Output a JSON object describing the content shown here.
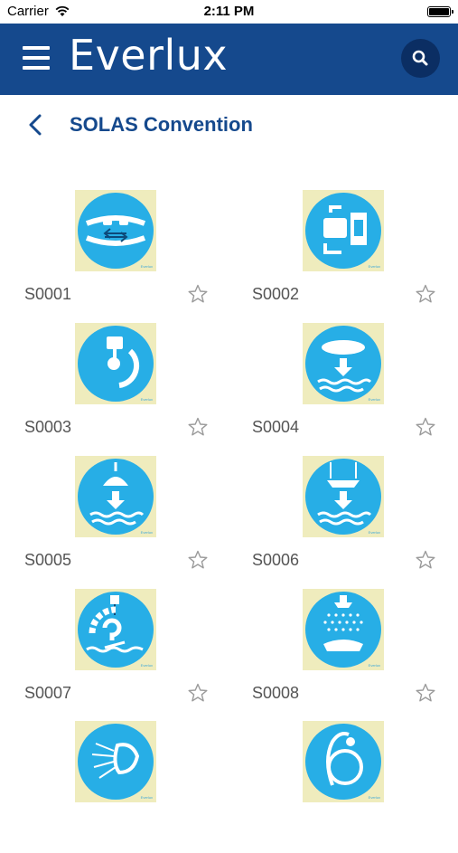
{
  "status": {
    "carrier": "Carrier",
    "time": "2:11 PM"
  },
  "header": {
    "brand": "Everlux"
  },
  "nav": {
    "title": "SOLAS Convention"
  },
  "icons": {
    "menu": "hamburger-menu-icon",
    "search": "search-icon",
    "back": "chevron-left-icon",
    "favorite": "star-outline-icon"
  },
  "colors": {
    "header": "#15498d",
    "search_bg": "#0b2e63",
    "sign_blue": "#27aee6",
    "sign_bg": "#efecbd",
    "title": "#15498d"
  },
  "items": [
    {
      "code": "S0001"
    },
    {
      "code": "S0002"
    },
    {
      "code": "S0003"
    },
    {
      "code": "S0004"
    },
    {
      "code": "S0005"
    },
    {
      "code": "S0006"
    },
    {
      "code": "S0007"
    },
    {
      "code": "S0008"
    },
    {
      "code": ""
    },
    {
      "code": ""
    }
  ]
}
